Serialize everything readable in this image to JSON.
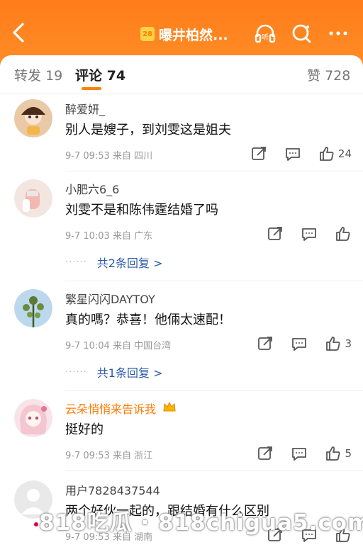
{
  "header": {
    "title": "曝井柏然...",
    "badge": "28",
    "back_icon": "chevron-left-icon",
    "listen_label": "听"
  },
  "tabs": {
    "repost_label": "转发",
    "repost_count": "19",
    "comment_label": "评论",
    "comment_count": "74",
    "like_label": "赞",
    "like_count": "728"
  },
  "comments": [
    {
      "username": "醉爱妍_",
      "text": "别人是嫂子，到刘雯这是姐夫",
      "meta": "9-7 09:53 来自 四川",
      "likes": "24",
      "vip": false
    },
    {
      "username": "小肥六6_6",
      "text": "刘雯不是和陈伟霆结婚了吗",
      "meta": "9-7 10:03 来自 广东",
      "likes": "",
      "replies": "共2条回复 >",
      "vip": false
    },
    {
      "username": "繁星闪闪DAYTOY",
      "text": "真的嗎？恭喜！他倆太速配！",
      "meta": "9-7 10:04 来自 中国台湾",
      "likes": "3",
      "replies": "共1条回复 >",
      "vip": false
    },
    {
      "username": "云朵悄悄来告诉我",
      "text": "挺好的",
      "meta": "9-7 09:53 来自 浙江",
      "likes": "5",
      "vip": true
    },
    {
      "username": "用户7828437544",
      "text": "两个好伙一起的，跟结婚有什么区别",
      "meta": "9-7 09:53 来自 湖南",
      "likes": "",
      "vip": false
    }
  ],
  "watermark": "818吃瓜 · 818chigua5.com",
  "colors": {
    "brand_orange": "#ff8200",
    "reply_blue": "#2a5caa"
  }
}
